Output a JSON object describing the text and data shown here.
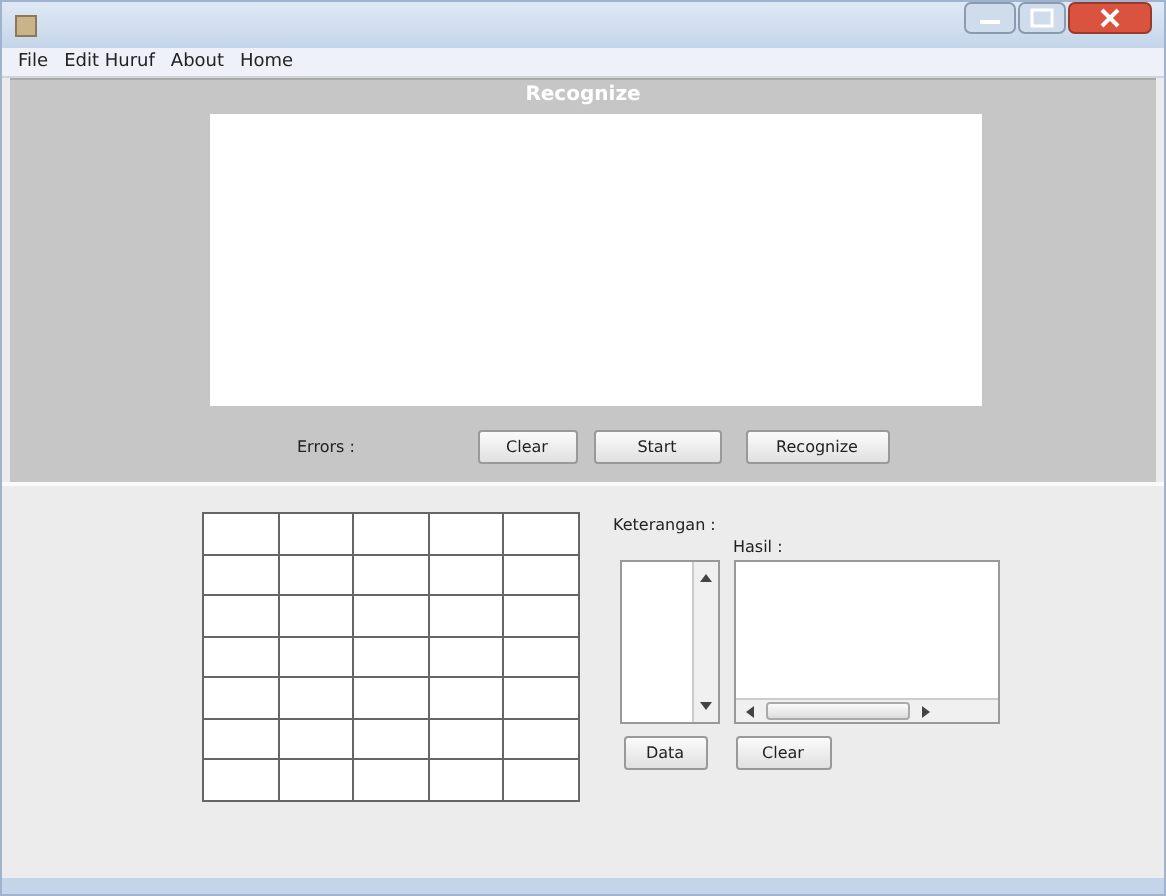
{
  "menu": [
    "File",
    "Edit Huruf",
    "About",
    "Home"
  ],
  "recognize_panel": {
    "title": "Recognize",
    "errors_label": "Errors :",
    "buttons": [
      "Clear",
      "Start",
      "Recognize"
    ]
  },
  "grid": [
    [
      {
        "filled": false
      },
      {
        "filled": false
      },
      {
        "filled": false
      },
      {
        "filled": false
      },
      {
        "filled": false
      }
    ],
    [
      {
        "filled": false
      },
      {
        "filled": false
      },
      {
        "filled": false
      },
      {
        "filled": false
      },
      {
        "filled": false
      }
    ],
    [
      {
        "filled": false
      },
      {
        "filled": false
      },
      {
        "filled": false
      },
      {
        "filled": false
      },
      {
        "filled": false
      }
    ],
    [
      {
        "filled": false
      },
      {
        "filled": false
      },
      {
        "filled": false
      },
      {
        "filled": false
      },
      {
        "filled": false
      }
    ],
    [
      {
        "filled": false
      },
      {
        "filled": false
      },
      {
        "filled": false
      },
      {
        "filled": false
      },
      {
        "filled": false
      }
    ],
    [
      {
        "filled": false
      },
      {
        "filled": false
      },
      {
        "filled": false
      },
      {
        "filled": false
      },
      {
        "filled": false
      }
    ],
    [
      {
        "filled": false
      },
      {
        "filled": false
      },
      {
        "filled": false
      },
      {
        "filled": false
      },
      {
        "filled": false
      }
    ]
  ],
  "keterangan_label": "Keterangan :",
  "hasil_label": "Hasil :",
  "bottom_buttons": [
    "Data",
    "Clear"
  ]
}
